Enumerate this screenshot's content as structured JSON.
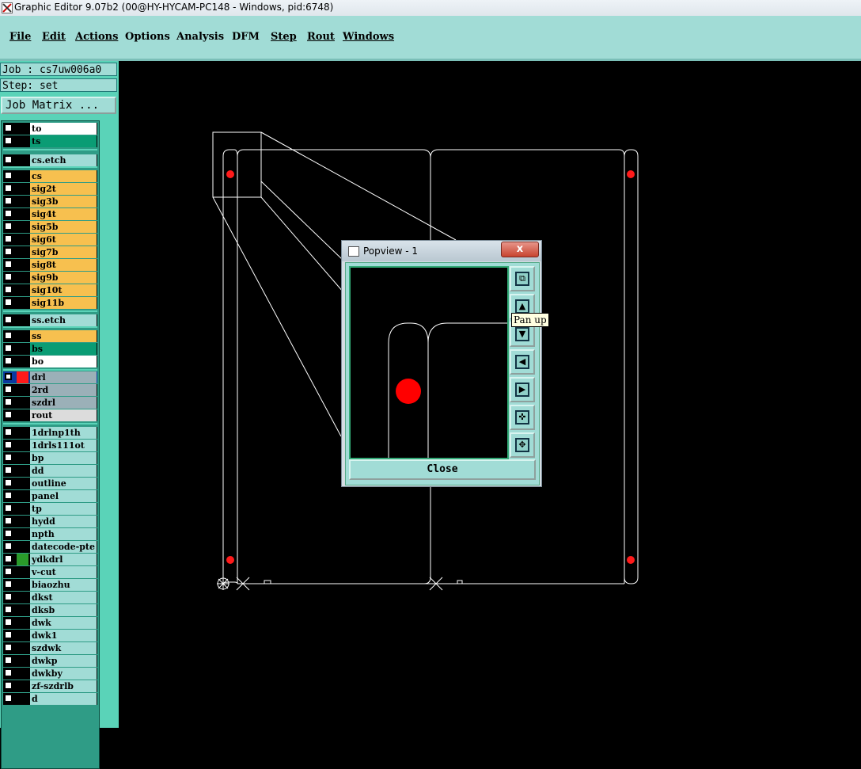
{
  "window": {
    "title": "Graphic Editor 9.07b2 (00@HY-HYCAM-PC148 - Windows, pid:6748)"
  },
  "menu": [
    {
      "label": "File"
    },
    {
      "label": "Edit"
    },
    {
      "label": "Actions"
    },
    {
      "label": "Options"
    },
    {
      "label": "Analysis"
    },
    {
      "label": "DFM"
    },
    {
      "label": "Step"
    },
    {
      "label": "Rout"
    },
    {
      "label": "Windows"
    }
  ],
  "job": {
    "label": "Job : cs7uw006a0",
    "step": "Step: set",
    "matrix_button": "Job Matrix ..."
  },
  "layers": [
    {
      "name": "to",
      "bg": "#ffffff"
    },
    {
      "name": "ts",
      "bg": "#0a9c74"
    },
    {
      "name": "cs.etch",
      "bg": "#a1dcd6"
    },
    {
      "name": "cs",
      "bg": "#f7c04f"
    },
    {
      "name": "sig2t",
      "bg": "#f7c04f"
    },
    {
      "name": "sig3b",
      "bg": "#f7c04f"
    },
    {
      "name": "sig4t",
      "bg": "#f7c04f"
    },
    {
      "name": "sig5b",
      "bg": "#f7c04f"
    },
    {
      "name": "sig6t",
      "bg": "#f7c04f"
    },
    {
      "name": "sig7b",
      "bg": "#f7c04f"
    },
    {
      "name": "sig8t",
      "bg": "#f7c04f"
    },
    {
      "name": "sig9b",
      "bg": "#f7c04f"
    },
    {
      "name": "sig10t",
      "bg": "#f7c04f"
    },
    {
      "name": "sig11b",
      "bg": "#f7c04f"
    },
    {
      "name": "ss.etch",
      "bg": "#a1dcd6"
    },
    {
      "name": "ss",
      "bg": "#f7c04f"
    },
    {
      "name": "bs",
      "bg": "#0a9c74"
    },
    {
      "name": "bo",
      "bg": "#ffffff"
    },
    {
      "name": "drl",
      "bg": "#9bb0b8"
    },
    {
      "name": "2rd",
      "bg": "#9bb0b8"
    },
    {
      "name": "szdrl",
      "bg": "#9bb0b8"
    },
    {
      "name": "rout",
      "bg": "#dcdcdc"
    },
    {
      "name": "1drlnp1th",
      "bg": "#a1dcd6"
    },
    {
      "name": "1drls111ot",
      "bg": "#a1dcd6"
    },
    {
      "name": "bp",
      "bg": "#a1dcd6"
    },
    {
      "name": "dd",
      "bg": "#a1dcd6"
    },
    {
      "name": "outline",
      "bg": "#a1dcd6"
    },
    {
      "name": "panel",
      "bg": "#a1dcd6"
    },
    {
      "name": "tp",
      "bg": "#a1dcd6"
    },
    {
      "name": "hydd",
      "bg": "#a1dcd6"
    },
    {
      "name": "npth",
      "bg": "#a1dcd6"
    },
    {
      "name": "datecode-pte",
      "bg": "#a1dcd6"
    },
    {
      "name": "ydkdrl",
      "bg": "#a1dcd6"
    },
    {
      "name": "v-cut",
      "bg": "#a1dcd6"
    },
    {
      "name": "biaozhu",
      "bg": "#a1dcd6"
    },
    {
      "name": "dkst",
      "bg": "#a1dcd6"
    },
    {
      "name": "dksb",
      "bg": "#a1dcd6"
    },
    {
      "name": "dwk",
      "bg": "#a1dcd6"
    },
    {
      "name": "dwk1",
      "bg": "#a1dcd6"
    },
    {
      "name": "szdwk",
      "bg": "#a1dcd6"
    },
    {
      "name": "dwkp",
      "bg": "#a1dcd6"
    },
    {
      "name": "dwkby",
      "bg": "#a1dcd6"
    },
    {
      "name": "zf-szdrlb",
      "bg": "#a1dcd6"
    },
    {
      "name": "d",
      "bg": "#a1dcd6"
    }
  ],
  "popview": {
    "title": "Popview - 1",
    "close_label": "Close",
    "close_x": "x",
    "tooltip": "Pan up"
  }
}
